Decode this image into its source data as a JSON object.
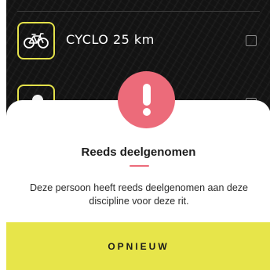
{
  "list": {
    "items": [
      {
        "label": "CYCLO 25 km",
        "icon": "bicycle-icon",
        "checked": false
      },
      {
        "label": "",
        "icon": "runner-icon",
        "checked": false
      }
    ]
  },
  "dialog": {
    "icon": "exclamation-icon",
    "title": "Reeds deelgenomen",
    "message": "Deze persoon heeft reeds deelgenomen aan deze discipline voor deze rit.",
    "button_label": "OPNIEUW"
  },
  "colors": {
    "accent_yellow": "#e7e54a",
    "alert_pink": "#ec6b7a",
    "background_dark": "#131313"
  }
}
